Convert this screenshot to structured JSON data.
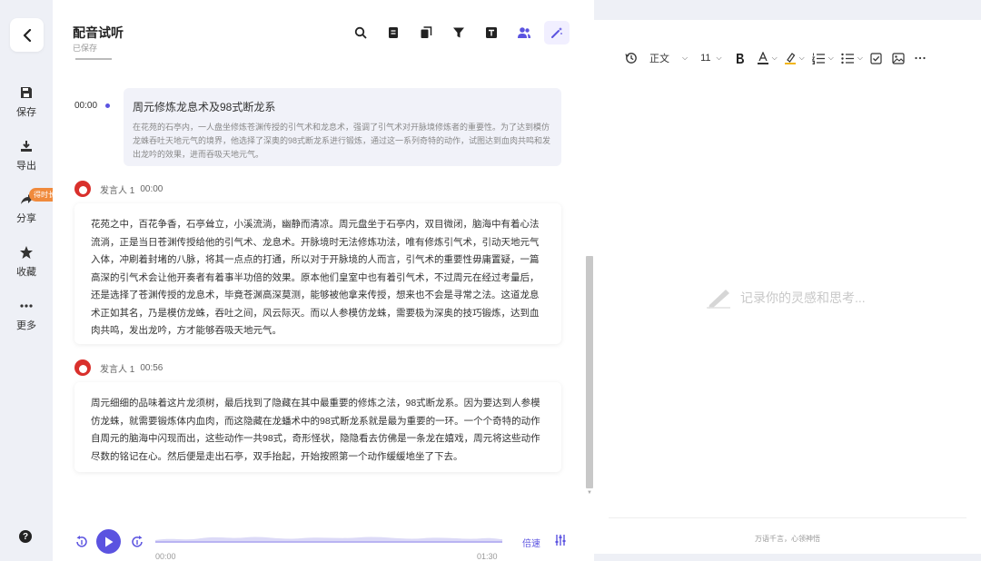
{
  "rail": {
    "items": [
      {
        "label": "保存",
        "icon": "save-icon"
      },
      {
        "label": "导出",
        "icon": "export-icon"
      },
      {
        "label": "分享",
        "icon": "share-icon"
      },
      {
        "label": "收藏",
        "icon": "star-icon"
      },
      {
        "label": "更多",
        "icon": "more-icon"
      }
    ],
    "share_badge": "得时长",
    "help": "?"
  },
  "header": {
    "title": "配音试听",
    "status": "已保存",
    "tools": [
      "search-icon",
      "notes-icon",
      "copy-icon",
      "filter-icon",
      "transcript-icon",
      "speakers-icon",
      "magic-wand-icon"
    ]
  },
  "summary": {
    "time": "00:00",
    "title": "周元修炼龙息术及98式断龙系",
    "body": "在花苑的石亭内，一人盘坐修炼苍渊传授的引气术和龙息术，强调了引气术对开脉境修炼者的重要性。为了达到模仿龙蛛吞吐天地元气的境界，他选择了深奥的98式断龙系进行锻炼，通过这一系列奇特的动作，试图达到血肉共鸣和发出龙吟的效果，进而吞吸天地元气。"
  },
  "segments": [
    {
      "speaker": "发言人 1",
      "time": "00:00",
      "text": "花苑之中，百花争香，石亭耸立，小溪流淌，幽静而清凉。周元盘坐于石亭内，双目微闭，脑海中有着心法流淌，正是当日苍渊传授给他的引气术、龙息术。开脉境时无法修炼功法，唯有修炼引气术，引动天地元气入体，冲刷着封堵的八脉，将其一点点的打通，所以对于开脉境的人而言，引气术的重要性毋庸置疑，一篇高深的引气术会让他开奏者有着事半功倍的效果。原本他们皇室中也有着引气术，不过周元在经过考量后，还是选择了苍渊传授的龙息术，毕竟苍渊高深莫测，能够被他拿来传授，想来也不会是寻常之法。这道龙息术正如其名，乃是模仿龙蛛，吞吐之间，风云际灭。而以人参模仿龙蛛，需要极为深奥的技巧锻炼，达到血肉共鸣，发出龙吟，方才能够吞吸天地元气。"
    },
    {
      "speaker": "发言人 1",
      "time": "00:56",
      "text": "周元细细的品味着这片龙须树，最后找到了隐藏在其中最重要的修炼之法，98式断龙系。因为要达到人参模仿龙蛛，就需要锻炼体内血肉，而这隐藏在龙蟠术中的98式断龙系就是最为重要的一环。一个个奇特的动作自周元的脑海中闪现而出，这些动作一共98式，奇形怪状，隐隐看去仿佛是一条龙在嬉戏，周元将这些动作尽数的铭记在心。然后便是走出石亭，双手抬起，开始按照第一个动作缓缓地坐了下去。"
    }
  ],
  "player": {
    "current": "00:00",
    "total": "01:30",
    "speed_label": "倍速",
    "progress": 0
  },
  "editor": {
    "style": "正文",
    "font_size": "11",
    "placeholder": "记录你的灵感和思考...",
    "footer": "万语千言，心领神悟"
  },
  "colors": {
    "accent": "#5b53e0",
    "badge": "#f08a3c",
    "avatar": "#d9302c"
  }
}
